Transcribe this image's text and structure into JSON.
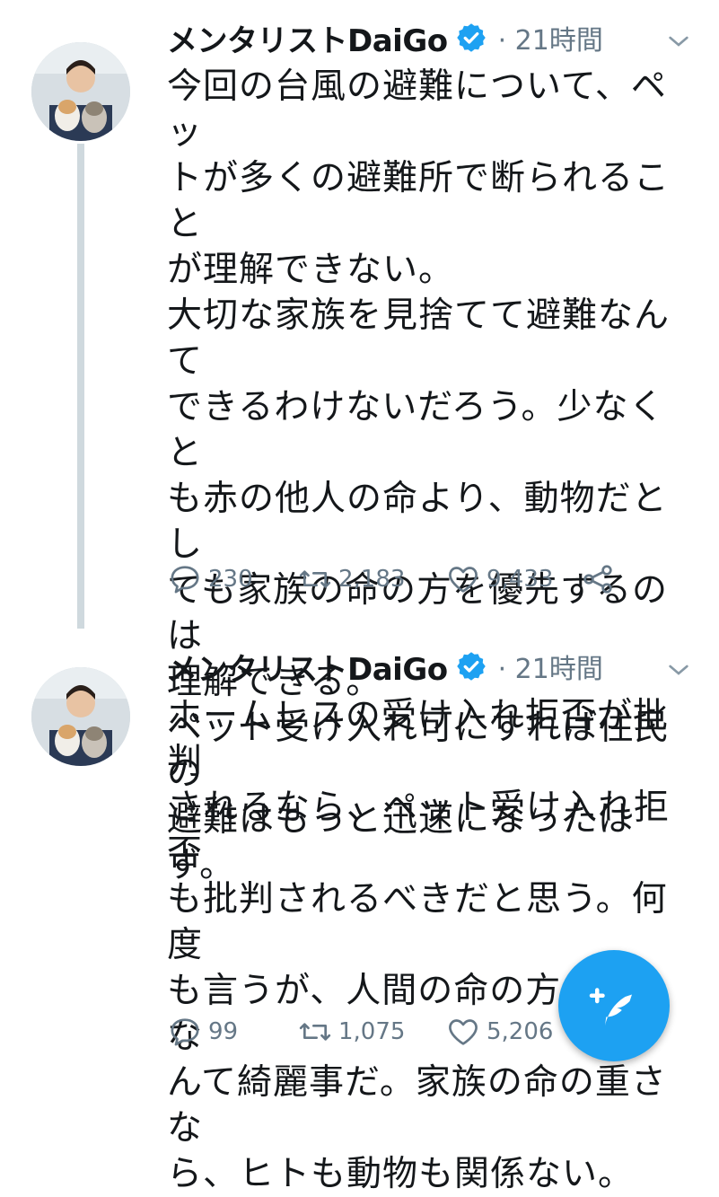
{
  "tweets": [
    {
      "author": "メンタリストDaiGo",
      "meta": "· 21時間",
      "lines": [
        "今回の台風の避難について、ペッ",
        "トが多くの避難所で断られること",
        "が理解できない。",
        "大切な家族を見捨てて避難なんて",
        "できるわけないだろう。少なくと",
        "も赤の他人の命より、動物だとし",
        "ても家族の命の方を優先するのは",
        "理解できる。",
        "ペット受け入れ可にすれば住民の",
        "避難はもっと迅速になったはず。"
      ],
      "replies": "230",
      "retweets": "2,183",
      "likes": "9,433"
    },
    {
      "author": "メンタリストDaiGo",
      "meta": "· 21時間",
      "lines": [
        "ホームレスの受け入れ拒否が批判",
        "されるなら、ペット受け入れ拒否",
        "も批判されるべきだと思う。何度",
        "も言うが、人間の命の方が重いな",
        "んて綺麗事だ。家族の命の重さな",
        "ら、ヒトも動物も関係ない。"
      ],
      "replies": "99",
      "retweets": "1,075",
      "likes": "5,206"
    }
  ],
  "colors": {
    "accent": "#1da1f2",
    "muted": "#657786",
    "thread_line": "#cfd9de"
  },
  "icons": {
    "verified": "verified-badge-icon",
    "caret": "chevron-down-icon",
    "reply": "reply-icon",
    "retweet": "retweet-icon",
    "like": "heart-icon",
    "share": "share-icon",
    "compose": "compose-tweet-icon"
  }
}
